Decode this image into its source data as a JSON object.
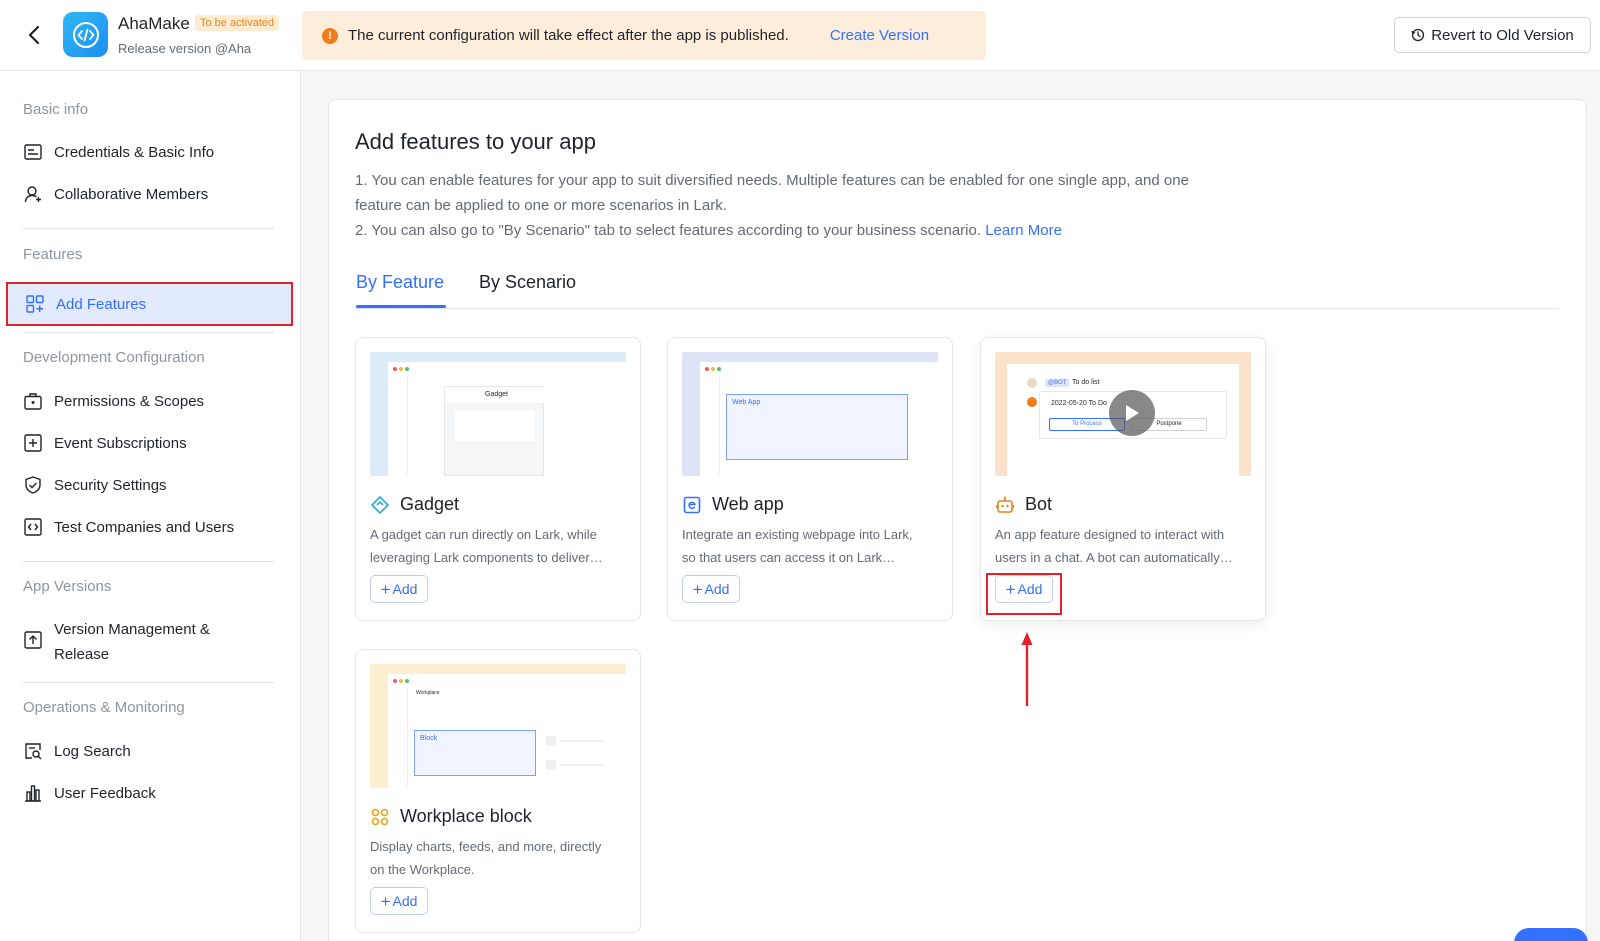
{
  "header": {
    "app_name": "AhaMake",
    "status_badge": "To be activated",
    "release_label": "Release version @Aha",
    "banner_text": "The current configuration will take effect after the app is published.",
    "banner_link": "Create Version",
    "revert_button": "Revert to Old Version"
  },
  "sidebar": {
    "sections": {
      "basic": "Basic info",
      "features": "Features",
      "dev": "Development Configuration",
      "versions": "App Versions",
      "ops": "Operations & Monitoring"
    },
    "items": {
      "credentials": "Credentials & Basic Info",
      "members": "Collaborative Members",
      "add_features": "Add Features",
      "permissions": "Permissions & Scopes",
      "events": "Event Subscriptions",
      "security": "Security Settings",
      "test": "Test Companies and Users",
      "version_mgmt_1": "Version Management &",
      "version_mgmt_2": "Release",
      "log_search": "Log Search",
      "feedback": "User Feedback"
    }
  },
  "main": {
    "title": "Add features to your app",
    "desc_line1": "1. You can enable features for your app to suit diversified needs. Multiple features can be enabled for one single app, and one",
    "desc_line2": "feature can be applied to one or more scenarios in Lark.",
    "desc_line3": "2. You can also go to \"By Scenario\" tab to select features according to your business scenario.",
    "learn_more": "Learn More",
    "tabs": [
      "By Feature",
      "By Scenario"
    ],
    "add_label": "Add",
    "cards": [
      {
        "title": "Gadget",
        "desc1": "A gadget can run directly on Lark, while",
        "desc2": "leveraging Lark components to deliver…",
        "thumb_label": "Gadget"
      },
      {
        "title": "Web app",
        "desc1": "Integrate an existing webpage into Lark,",
        "desc2": "so that users can access it on Lark…",
        "thumb_label": "Web App"
      },
      {
        "title": "Bot",
        "desc1": "An app feature designed to interact with",
        "desc2": "users in a chat. A bot can automatically…",
        "thumb_bot_tag": "@BOT",
        "thumb_todo": "To do list",
        "thumb_date": "2022-05-20 To Do",
        "thumb_btn1": "To Process",
        "thumb_btn2": "Postpone"
      },
      {
        "title": "Workplace block",
        "desc1": "Display charts, feeds, and more, directly",
        "desc2": "on the Workplace.",
        "thumb_label": "Block",
        "thumb_header": "Workplace"
      }
    ]
  },
  "colors": {
    "accent": "#3370ff",
    "highlight": "#e5212a",
    "banner_bg": "#fdeedb",
    "active_bg": "#e1eaff"
  }
}
